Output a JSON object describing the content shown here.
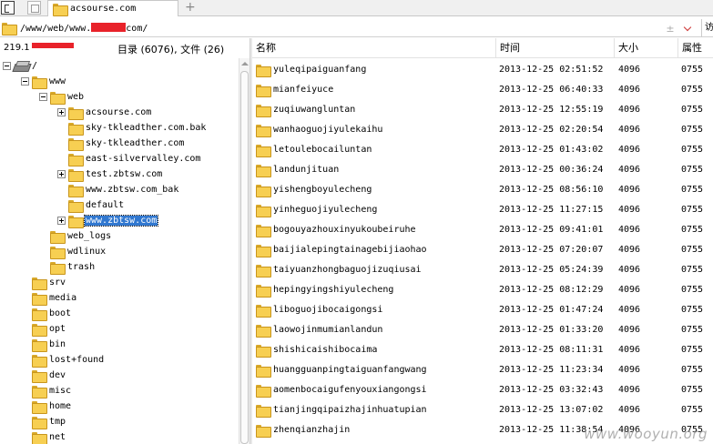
{
  "tab": {
    "label": "acsourse.com",
    "add_label": "+"
  },
  "address": {
    "path_prefix": "/www/web/www.",
    "path_suffix": "com/",
    "plus_minus": "±",
    "go_label": "访"
  },
  "left_header": {
    "ip_prefix": "219.1",
    "counts": "目录 (6076), 文件 (26)"
  },
  "tree": [
    {
      "label": "/",
      "icon": "drive-icon",
      "level": 0,
      "expander": "minus"
    },
    {
      "label": "www",
      "icon": "folder-icon",
      "level": 1,
      "expander": "minus"
    },
    {
      "label": "web",
      "icon": "folder-icon",
      "level": 2,
      "expander": "minus"
    },
    {
      "label": "acsourse.com",
      "icon": "folder-icon",
      "level": 3,
      "expander": "plus"
    },
    {
      "label": "sky-tkleadther.com.bak",
      "icon": "folder-icon",
      "level": 3,
      "expander": ""
    },
    {
      "label": "sky-tkleadther.com",
      "icon": "folder-icon",
      "level": 3,
      "expander": ""
    },
    {
      "label": "east-silvervalley.com",
      "icon": "folder-icon",
      "level": 3,
      "expander": ""
    },
    {
      "label": "test.zbtsw.com",
      "icon": "folder-icon",
      "level": 3,
      "expander": "plus"
    },
    {
      "label": "www.zbtsw.com_bak",
      "icon": "folder-icon",
      "level": 3,
      "expander": ""
    },
    {
      "label": "default",
      "icon": "folder-icon",
      "level": 3,
      "expander": ""
    },
    {
      "label": "www.zbtsw.com",
      "icon": "folder-icon",
      "level": 3,
      "expander": "plus",
      "selected": true
    },
    {
      "label": "web_logs",
      "icon": "folder-icon",
      "level": 2,
      "expander": ""
    },
    {
      "label": "wdlinux",
      "icon": "folder-icon",
      "level": 2,
      "expander": ""
    },
    {
      "label": "trash",
      "icon": "folder-icon",
      "level": 2,
      "expander": ""
    },
    {
      "label": "srv",
      "icon": "folder-icon",
      "level": 1,
      "expander": ""
    },
    {
      "label": "media",
      "icon": "folder-icon",
      "level": 1,
      "expander": ""
    },
    {
      "label": "boot",
      "icon": "folder-icon",
      "level": 1,
      "expander": ""
    },
    {
      "label": "opt",
      "icon": "folder-icon",
      "level": 1,
      "expander": ""
    },
    {
      "label": "bin",
      "icon": "folder-icon",
      "level": 1,
      "expander": ""
    },
    {
      "label": "lost+found",
      "icon": "folder-icon",
      "level": 1,
      "expander": ""
    },
    {
      "label": "dev",
      "icon": "folder-icon",
      "level": 1,
      "expander": ""
    },
    {
      "label": "misc",
      "icon": "folder-icon",
      "level": 1,
      "expander": ""
    },
    {
      "label": "home",
      "icon": "folder-icon",
      "level": 1,
      "expander": ""
    },
    {
      "label": "tmp",
      "icon": "folder-icon",
      "level": 1,
      "expander": ""
    },
    {
      "label": "net",
      "icon": "folder-icon",
      "level": 1,
      "expander": ""
    }
  ],
  "columns": {
    "name": "名称",
    "time": "时间",
    "size": "大小",
    "perm": "属性"
  },
  "files": [
    {
      "name": "yuleqipaiguanfang",
      "time": "2013-12-25 02:51:52",
      "size": "4096",
      "perm": "0755"
    },
    {
      "name": "mianfeiyuce",
      "time": "2013-12-25 06:40:33",
      "size": "4096",
      "perm": "0755"
    },
    {
      "name": "zuqiuwangluntan",
      "time": "2013-12-25 12:55:19",
      "size": "4096",
      "perm": "0755"
    },
    {
      "name": "wanhaoguojiyulekaihu",
      "time": "2013-12-25 02:20:54",
      "size": "4096",
      "perm": "0755"
    },
    {
      "name": "letoulebocailuntan",
      "time": "2013-12-25 01:43:02",
      "size": "4096",
      "perm": "0755"
    },
    {
      "name": "landunjituan",
      "time": "2013-12-25 00:36:24",
      "size": "4096",
      "perm": "0755"
    },
    {
      "name": "yishengboyulecheng",
      "time": "2013-12-25 08:56:10",
      "size": "4096",
      "perm": "0755"
    },
    {
      "name": "yinheguojiyulecheng",
      "time": "2013-12-25 11:27:15",
      "size": "4096",
      "perm": "0755"
    },
    {
      "name": "bogouyazhouxinyukoubeiruhe",
      "time": "2013-12-25 09:41:01",
      "size": "4096",
      "perm": "0755"
    },
    {
      "name": "baijialepingtainagebijiaohao",
      "time": "2013-12-25 07:20:07",
      "size": "4096",
      "perm": "0755"
    },
    {
      "name": "taiyuanzhongbaguojizuqiusai",
      "time": "2013-12-25 05:24:39",
      "size": "4096",
      "perm": "0755"
    },
    {
      "name": "hepingyingshiyulecheng",
      "time": "2013-12-25 08:12:29",
      "size": "4096",
      "perm": "0755"
    },
    {
      "name": "liboguojibocaigongsi",
      "time": "2013-12-25 01:47:24",
      "size": "4096",
      "perm": "0755"
    },
    {
      "name": "laowojinmumianlandun",
      "time": "2013-12-25 01:33:20",
      "size": "4096",
      "perm": "0755"
    },
    {
      "name": "shishicaishibocaima",
      "time": "2013-12-25 08:11:31",
      "size": "4096",
      "perm": "0755"
    },
    {
      "name": "huangguanpingtaiguanfangwang",
      "time": "2013-12-25 11:23:34",
      "size": "4096",
      "perm": "0755"
    },
    {
      "name": "aomenbocaigufenyouxiangongsi",
      "time": "2013-12-25 03:32:43",
      "size": "4096",
      "perm": "0755"
    },
    {
      "name": "tianjingqipaizhajinhuatupian",
      "time": "2013-12-25 13:07:02",
      "size": "4096",
      "perm": "0755"
    },
    {
      "name": "zhenqianzhajin",
      "time": "2013-12-25 11:38:54",
      "size": "4096",
      "perm": "0755"
    }
  ],
  "watermark": "www.wooyun.org",
  "colors": {
    "selection": "#3178d0",
    "folder": "#f7cf52",
    "redaction": "#e8222a"
  }
}
